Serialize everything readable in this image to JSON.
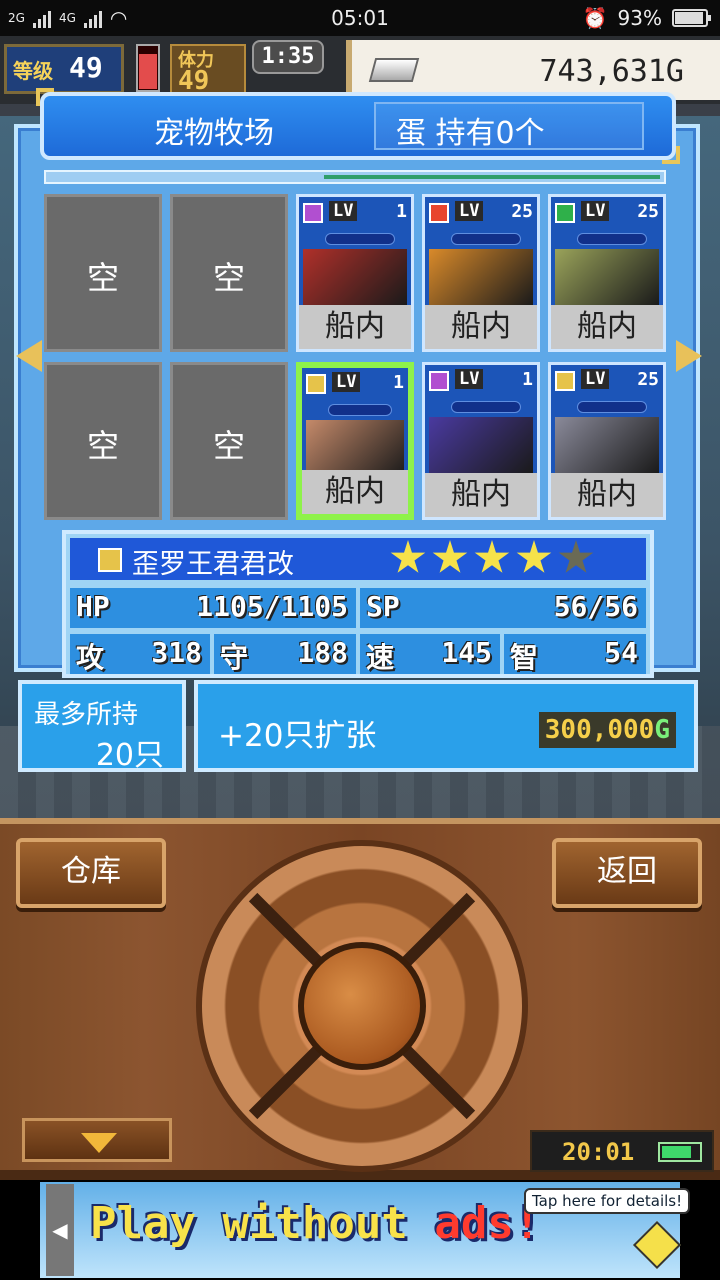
{
  "status_bar": {
    "network_left": "2G",
    "network_right": "4G",
    "time": "05:01",
    "battery": "93%",
    "battery_level": 0.93
  },
  "hud": {
    "level_label": "等级",
    "level_value": "49",
    "stamina_label": "体力",
    "stamina_value": "49",
    "timer": "1:35",
    "gold": "743,631G"
  },
  "pet_farm": {
    "title": "宠物牧场",
    "egg_status": "蛋 持有0个",
    "progress": 0.55,
    "slots": [
      {
        "type": "empty",
        "label": "空"
      },
      {
        "type": "empty",
        "label": "空"
      },
      {
        "type": "pet",
        "element": "purple",
        "lv_tag": "LV",
        "level": "1",
        "location": "船内",
        "art_color": "#b0302a",
        "selected": false
      },
      {
        "type": "pet",
        "element": "red",
        "lv_tag": "LV",
        "level": "25",
        "location": "船内",
        "art_color": "#d98a2a",
        "selected": false
      },
      {
        "type": "pet",
        "element": "green",
        "lv_tag": "LV",
        "level": "25",
        "location": "船内",
        "art_color": "#9aa35a",
        "selected": false
      },
      {
        "type": "empty",
        "label": "空"
      },
      {
        "type": "empty",
        "label": "空"
      },
      {
        "type": "pet",
        "element": "yellow",
        "lv_tag": "LV",
        "level": "1",
        "location": "船内",
        "art_color": "#c58a6a",
        "selected": true
      },
      {
        "type": "pet",
        "element": "purple",
        "lv_tag": "LV",
        "level": "1",
        "location": "船内",
        "art_color": "#4a3aa0",
        "selected": false
      },
      {
        "type": "pet",
        "element": "yellow",
        "lv_tag": "LV",
        "level": "25",
        "location": "船内",
        "art_color": "#8a8a9a",
        "selected": false
      }
    ]
  },
  "selected_pet": {
    "name": "歪罗王君君改",
    "stars": 4,
    "max_stars": 5,
    "hp_label": "HP",
    "hp_value": "1105/1105",
    "sp_label": "SP",
    "sp_value": "56/56",
    "atk_label": "攻",
    "atk_value": "318",
    "def_label": "守",
    "def_value": "188",
    "spd_label": "速",
    "spd_value": "145",
    "int_label": "智",
    "int_value": "54"
  },
  "capacity": {
    "max_label": "最多所持",
    "max_value": "20只",
    "expand_label": "+20只扩张",
    "expand_price": "300,000",
    "currency": "G"
  },
  "controls": {
    "warehouse_button": "仓库",
    "back_button": "返回",
    "clock": "20:01",
    "battery_level": 0.8
  },
  "ad": {
    "text_main": "Play without",
    "text_accent": "ads!",
    "tip": "Tap here for details!",
    "back_glyph": "◀"
  },
  "colors": {
    "panel_blue": "#5ea8e8",
    "header_blue": "#1e6ad8",
    "selected_border": "#8ef24a",
    "star_on": "#f6e24a",
    "gold_text": "#f5cf4a",
    "wood": "#7b4a26"
  }
}
